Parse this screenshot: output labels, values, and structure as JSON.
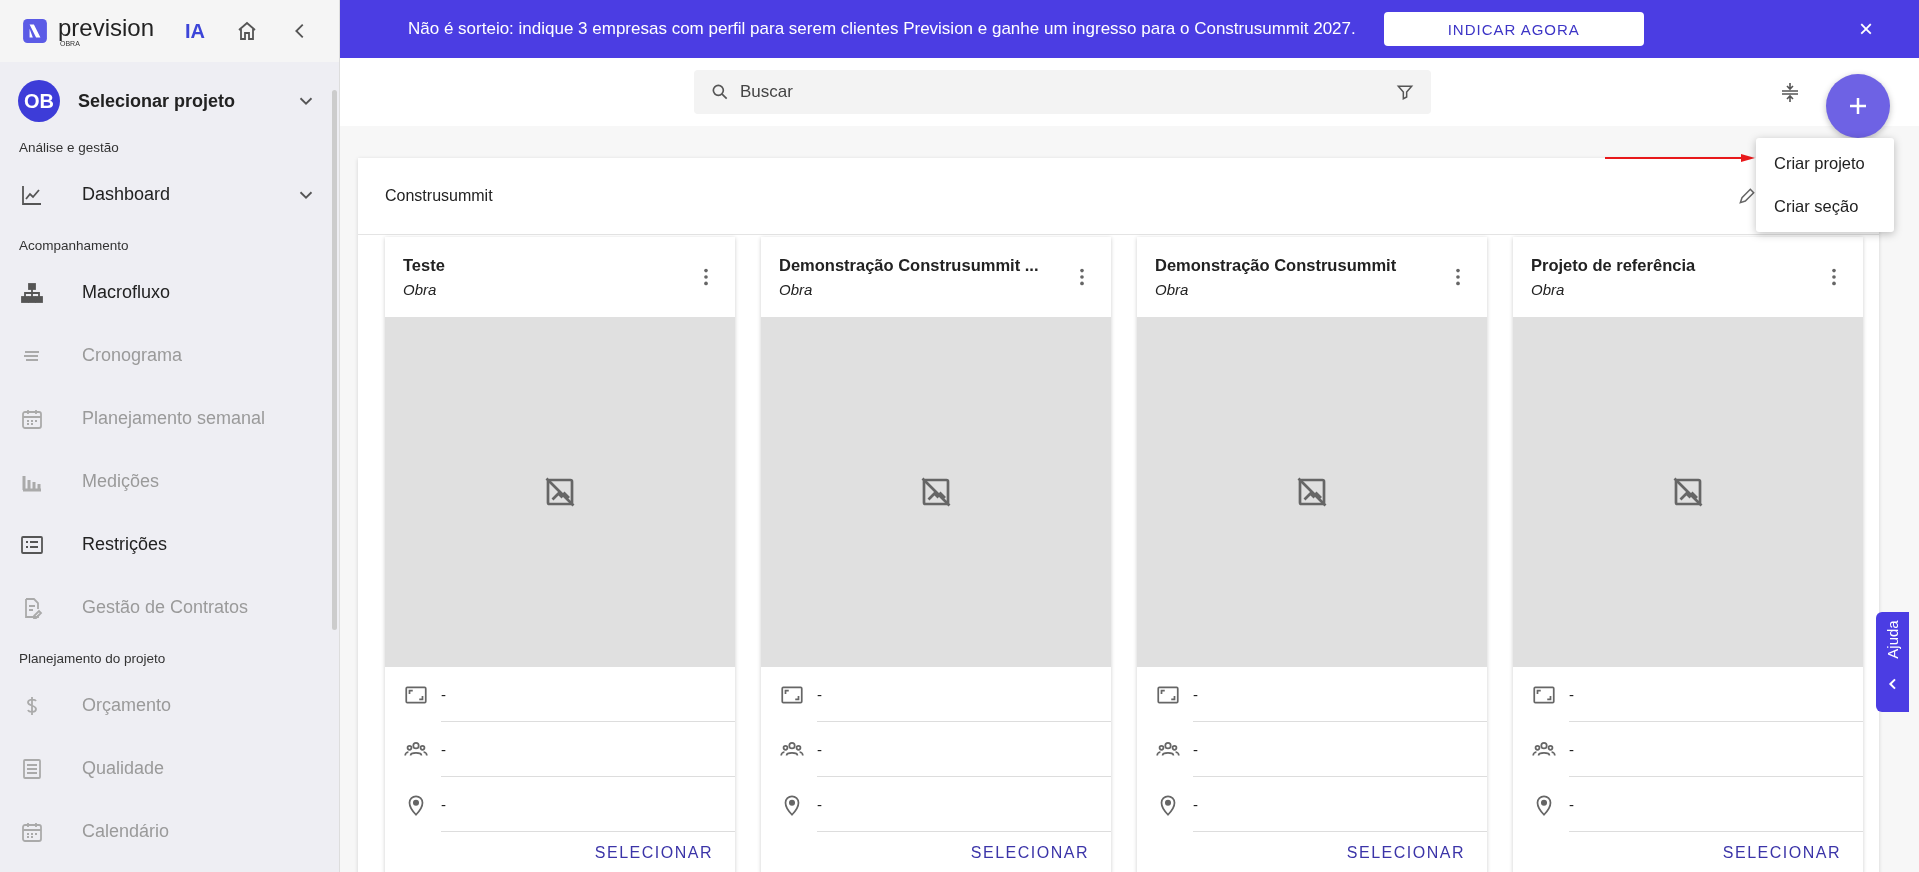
{
  "sidebar": {
    "brand": {
      "name": "prevision",
      "sub": "OBRA",
      "ai": "IA"
    },
    "project": {
      "initials": "OB",
      "label": "Selecionar projeto"
    },
    "groups": [
      {
        "title": "Análise e gestão",
        "items": [
          {
            "label": "Dashboard",
            "kind": "dropdown",
            "disabled": false
          }
        ]
      },
      {
        "title": "Acompanhamento",
        "items": [
          {
            "label": "Macrofluxo",
            "kind": "link",
            "disabled": false
          },
          {
            "label": "Cronograma",
            "kind": "link",
            "disabled": true
          },
          {
            "label": "Planejamento semanal",
            "kind": "link",
            "disabled": true
          },
          {
            "label": "Medições",
            "kind": "link",
            "disabled": true
          },
          {
            "label": "Restrições",
            "kind": "link",
            "disabled": false
          },
          {
            "label": "Gestão de Contratos",
            "kind": "link",
            "disabled": true
          }
        ]
      },
      {
        "title": "Planejamento do projeto",
        "items": [
          {
            "label": "Orçamento",
            "kind": "link",
            "disabled": true
          },
          {
            "label": "Qualidade",
            "kind": "link",
            "disabled": true
          },
          {
            "label": "Calendário",
            "kind": "link",
            "disabled": true
          }
        ]
      }
    ]
  },
  "banner": {
    "text": "Não é sorteio: indique 3 empresas com perfil para serem clientes Prevision e ganhe um ingresso para o Construsummit 2027.",
    "button": "INDICAR AGORA",
    "close": "×"
  },
  "search": {
    "placeholder": "Buscar"
  },
  "fab_menu": {
    "items": [
      "Criar projeto",
      "Criar seção"
    ]
  },
  "section": {
    "title": "Construsummit",
    "cards": [
      {
        "title": "Teste",
        "subtitle": "Obra",
        "rows": [
          "-",
          "-",
          "-"
        ],
        "button": "SELECIONAR"
      },
      {
        "title": "Demonstração Construsummit ...",
        "subtitle": "Obra",
        "rows": [
          "-",
          "-",
          "-"
        ],
        "button": "SELECIONAR"
      },
      {
        "title": "Demonstração Construsummit",
        "subtitle": "Obra",
        "rows": [
          "-",
          "-",
          "-"
        ],
        "button": "SELECIONAR"
      },
      {
        "title": "Projeto de referência",
        "subtitle": "Obra",
        "rows": [
          "-",
          "-",
          "-"
        ],
        "button": "SELECIONAR"
      }
    ]
  },
  "help_tab": {
    "label": "Ajuda"
  }
}
